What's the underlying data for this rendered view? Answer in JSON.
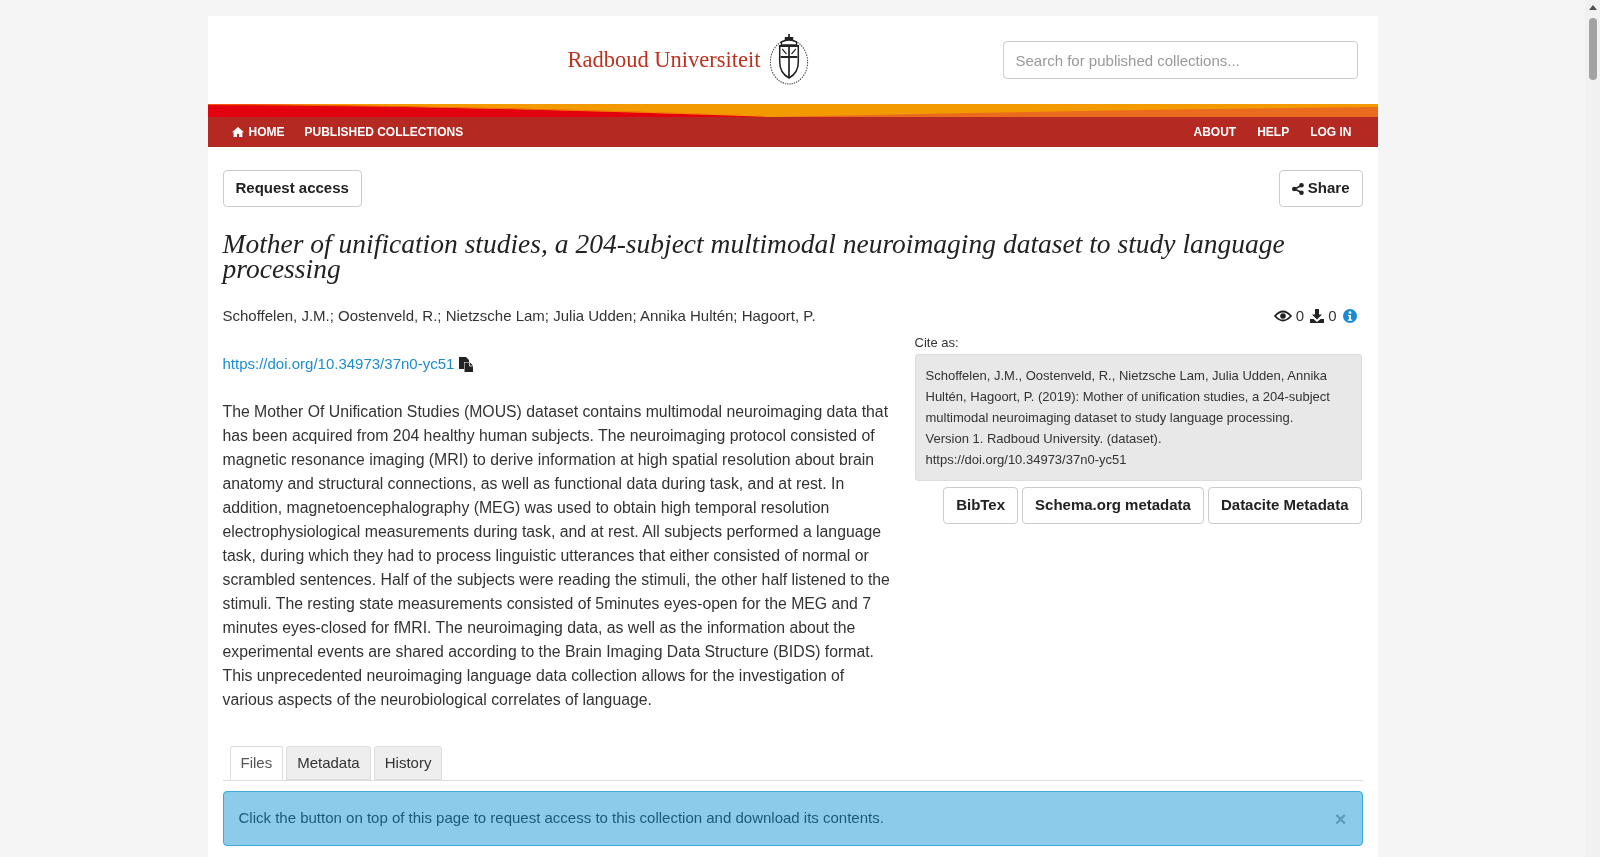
{
  "header": {
    "logo_text": "Radboud Universiteit",
    "search": {
      "placeholder": "Search for published collections..."
    }
  },
  "nav": {
    "left": [
      {
        "label": "HOME"
      },
      {
        "label": "PUBLISHED COLLECTIONS"
      }
    ],
    "right": [
      {
        "label": "ABOUT"
      },
      {
        "label": "HELP"
      },
      {
        "label": "LOG IN"
      }
    ]
  },
  "actions": {
    "request_access": "Request access",
    "share": "Share"
  },
  "title": "Mother of unification studies, a 204-subject multimodal neuroimaging dataset to study language processing",
  "authors": "Schoffelen, J.M.; Oostenveld, R.; Nietzsche Lam; Julia Udden; Annika Hultén; Hagoort, P.",
  "doi": "https://doi.org/10.34973/37n0-yc51",
  "description": "The Mother Of Unification Studies (MOUS) dataset contains multimodal neuroimaging data that has been acquired from 204 healthy human subjects. The neuroimaging protocol consisted of magnetic resonance imaging (MRI) to derive information at high spatial resolution about brain anatomy and structural connections, as well as functional data during task, and at rest. In addition, magnetoencephalography (MEG) was used to obtain high temporal resolution electrophysiological measurements during task, and at rest. All subjects performed a language task, during which they had to process linguistic utterances that either consisted of normal or scrambled sentences. Half of the subjects were reading the stimuli, the other half listened to the stimuli. The resting state measurements consisted of 5minutes eyes-open for the MEG and 7 minutes eyes-closed for fMRI. The neuroimaging data, as well as the information about the experimental events are shared according to the Brain Imaging Data Structure (BIDS) format. This unprecedented neuroimaging language data collection allows for the investigation of various aspects of the neurobiological correlates of language.",
  "stats": {
    "views": "0",
    "downloads": "0"
  },
  "citation": {
    "label": "Cite as:",
    "text": "Schoffelen, J.M., Oostenveld, R., Nietzsche Lam, Julia Udden, Annika Hultén, Hagoort, P. (2019): Mother of unification studies, a 204-subject multimodal neuroimaging dataset to study language processing. Version 1. Radboud University. (dataset). https://doi.org/10.34973/37n0-yc51",
    "buttons": [
      "BibTex",
      "Schema.org metadata",
      "Datacite Metadata"
    ]
  },
  "tabs": [
    {
      "label": "Files",
      "selected": true
    },
    {
      "label": "Metadata",
      "selected": false
    },
    {
      "label": "History",
      "selected": false
    }
  ],
  "alert": {
    "text": "Click the button on top of this page to request access to this collection and download its contents.",
    "close": "×"
  }
}
